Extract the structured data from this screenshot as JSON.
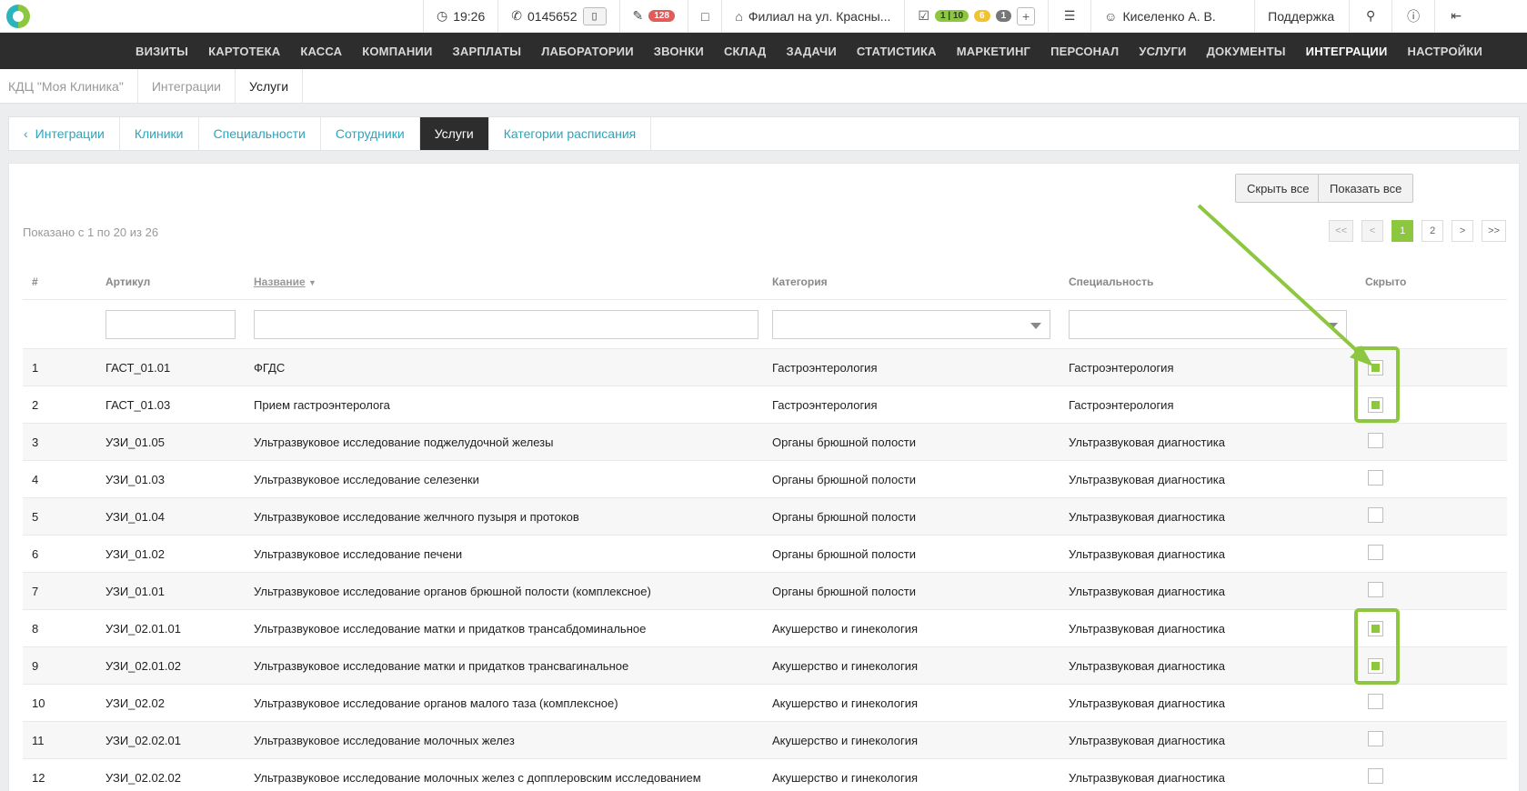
{
  "topbar": {
    "time": "19:26",
    "phone": "0145652",
    "messages_count": "128",
    "branch": "Филиал на ул. Красны...",
    "tasks_badge_green": "1 | 10",
    "tasks_badge_yellow": "6",
    "tasks_badge_gray": "1",
    "user": "Киселенко А. В.",
    "support": "Поддержка"
  },
  "nav": {
    "items": [
      "ВИЗИТЫ",
      "КАРТОТЕКА",
      "КАССА",
      "КОМПАНИИ",
      "ЗАРПЛАТЫ",
      "ЛАБОРАТОРИИ",
      "ЗВОНКИ",
      "СКЛАД",
      "ЗАДАЧИ",
      "СТАТИСТИКА",
      "МАРКЕТИНГ",
      "ПЕРСОНАЛ",
      "УСЛУГИ",
      "ДОКУМЕНТЫ",
      "ИНТЕГРАЦИИ",
      "НАСТРОЙКИ"
    ],
    "active": "ИНТЕГРАЦИИ"
  },
  "breadcrumb": [
    "КДЦ \"Моя Клиника\"",
    "Интеграции",
    "Услуги"
  ],
  "tabs": [
    "Интеграции",
    "Клиники",
    "Специальности",
    "Сотрудники",
    "Услуги",
    "Категории расписания"
  ],
  "active_tab": "Услуги",
  "buttons": {
    "hide_all": "Скрыть все",
    "show_all": "Показать все"
  },
  "shown_info": "Показано с 1 по 20 из 26",
  "pager": [
    "<<",
    "<",
    "1",
    "2",
    ">",
    ">>"
  ],
  "pager_active": "1",
  "table": {
    "headers": [
      "#",
      "Артикул",
      "Название",
      "Категория",
      "Специальность",
      "Скрыто"
    ],
    "rows": [
      {
        "n": "1",
        "code": "ГАСТ_01.01",
        "name": "ФГДС",
        "category": "Гастроэнтерология",
        "specialty": "Гастроэнтерология",
        "hidden": true
      },
      {
        "n": "2",
        "code": "ГАСТ_01.03",
        "name": "Прием гастроэнтеролога",
        "category": "Гастроэнтерология",
        "specialty": "Гастроэнтерология",
        "hidden": true
      },
      {
        "n": "3",
        "code": "УЗИ_01.05",
        "name": "Ультразвуковое исследование поджелудочной железы",
        "category": "Органы брюшной полости",
        "specialty": "Ультразвуковая диагностика",
        "hidden": false
      },
      {
        "n": "4",
        "code": "УЗИ_01.03",
        "name": "Ультразвуковое исследование селезенки",
        "category": "Органы брюшной полости",
        "specialty": "Ультразвуковая диагностика",
        "hidden": false
      },
      {
        "n": "5",
        "code": "УЗИ_01.04",
        "name": "Ультразвуковое исследование желчного пузыря и протоков",
        "category": "Органы брюшной полости",
        "specialty": "Ультразвуковая диагностика",
        "hidden": false
      },
      {
        "n": "6",
        "code": "УЗИ_01.02",
        "name": "Ультразвуковое исследование печени",
        "category": "Органы брюшной полости",
        "specialty": "Ультразвуковая диагностика",
        "hidden": false
      },
      {
        "n": "7",
        "code": "УЗИ_01.01",
        "name": "Ультразвуковое исследование органов брюшной полости (комплексное)",
        "category": "Органы брюшной полости",
        "specialty": "Ультразвуковая диагностика",
        "hidden": false
      },
      {
        "n": "8",
        "code": "УЗИ_02.01.01",
        "name": "Ультразвуковое исследование матки и придатков трансабдоминальное",
        "category": "Акушерство и гинекология",
        "specialty": "Ультразвуковая диагностика",
        "hidden": true
      },
      {
        "n": "9",
        "code": "УЗИ_02.01.02",
        "name": "Ультразвуковое исследование матки и придатков трансвагинальное",
        "category": "Акушерство и гинекология",
        "specialty": "Ультразвуковая диагностика",
        "hidden": true
      },
      {
        "n": "10",
        "code": "УЗИ_02.02",
        "name": "Ультразвуковое исследование органов малого таза (комплексное)",
        "category": "Акушерство и гинекология",
        "specialty": "Ультразвуковая диагностика",
        "hidden": false
      },
      {
        "n": "11",
        "code": "УЗИ_02.02.01",
        "name": "Ультразвуковое исследование молочных желез",
        "category": "Акушерство и гинекология",
        "specialty": "Ультразвуковая диагностика",
        "hidden": false
      },
      {
        "n": "12",
        "code": "УЗИ_02.02.02",
        "name": "Ультразвуковое исследование молочных желез с допплеровским исследованием",
        "category": "Акушерство и гинекология",
        "specialty": "Ультразвуковая диагностика",
        "hidden": false
      }
    ]
  },
  "colors": {
    "accent": "#8dc63f",
    "link": "#2aa6bd",
    "nav_bg": "#2d2d2d"
  }
}
